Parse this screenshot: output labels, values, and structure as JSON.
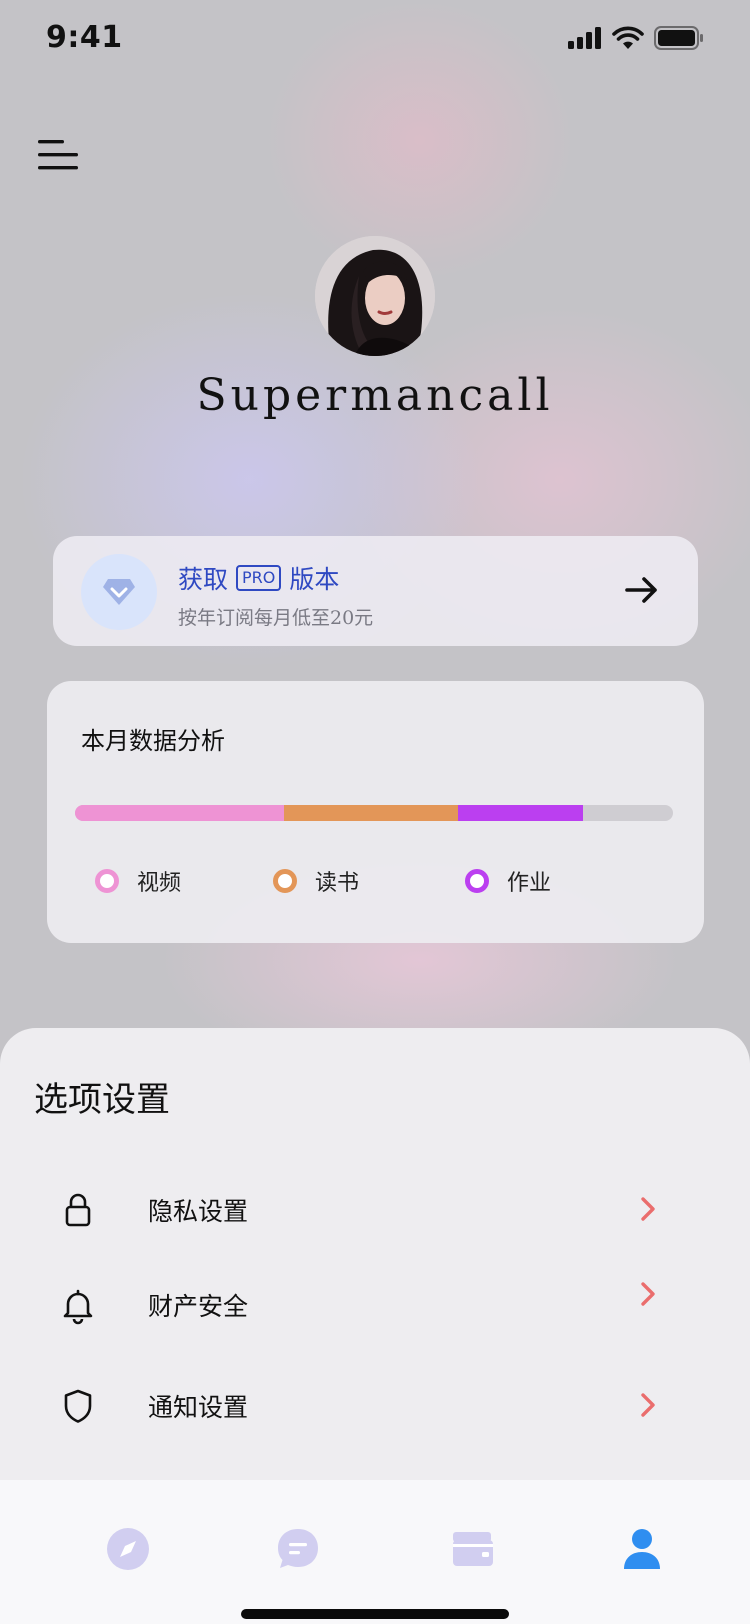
{
  "status_bar": {
    "time": "9:41"
  },
  "profile": {
    "username": "Supermancall"
  },
  "pro_card": {
    "title_prefix": "获取",
    "badge": "PRO",
    "title_suffix": "版本",
    "subtitle": "按年订阅每月低至20元"
  },
  "analysis": {
    "title": "本月数据分析",
    "segments": [
      {
        "label": "视频",
        "color": "#ee93d4",
        "fraction": 0.35
      },
      {
        "label": "读书",
        "color": "#e39658",
        "fraction": 0.29
      },
      {
        "label": "作业",
        "color": "#bb3ff0",
        "fraction": 0.21
      }
    ],
    "track_color": "#cfcdd2"
  },
  "settings": {
    "title": "选项设置",
    "items": [
      {
        "label": "隐私设置",
        "icon": "lock-icon"
      },
      {
        "label": "财产安全",
        "icon": "bell-icon"
      },
      {
        "label": "通知设置",
        "icon": "shield-icon"
      }
    ],
    "chevron_color": "#ea6d6d"
  },
  "tabbar": {
    "items": [
      {
        "icon": "compass-icon",
        "active": false
      },
      {
        "icon": "message-icon",
        "active": false
      },
      {
        "icon": "wallet-icon",
        "active": false
      },
      {
        "icon": "user-icon",
        "active": true
      }
    ],
    "active_color": "#2f8ef0",
    "inactive_color": "#d1cef0"
  }
}
